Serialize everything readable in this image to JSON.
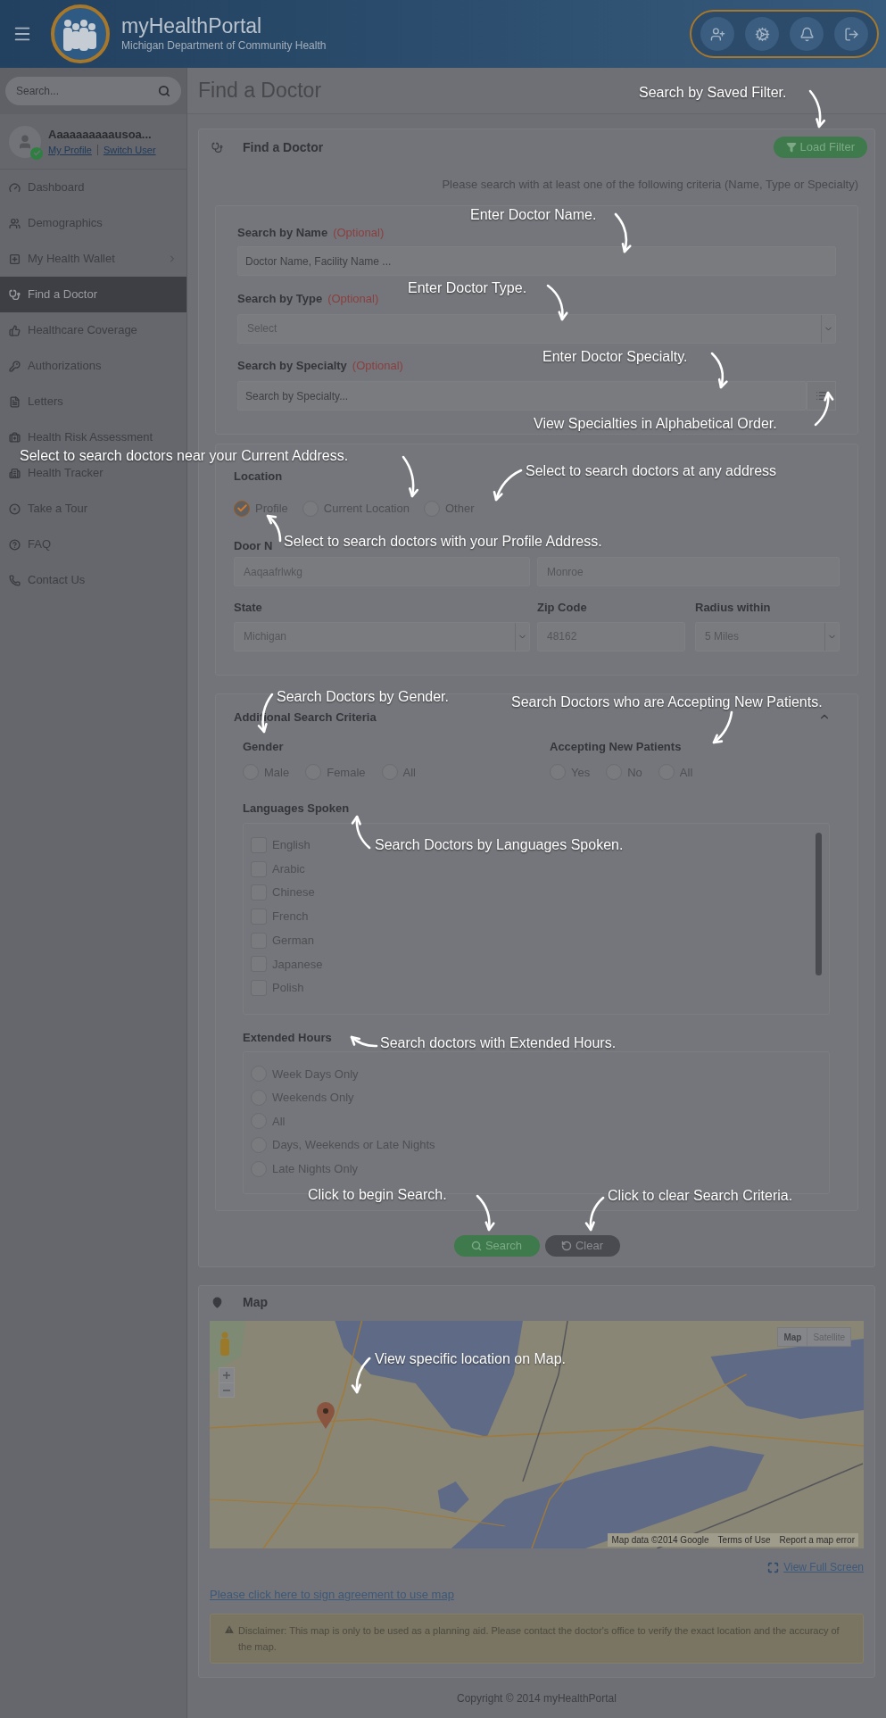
{
  "header": {
    "title": "myHealthPortal",
    "subtitle": "Michigan Department of Community Health"
  },
  "sidebar": {
    "search": {
      "placeholder": "Search..."
    },
    "user": {
      "name": "Aaaaaaaaaausoa...",
      "verified": true,
      "profile_link": "My Profile",
      "switch_link": "Switch User"
    },
    "items": [
      {
        "label": "Dashboard",
        "kind": "dashboard",
        "selected": false,
        "submenu": false
      },
      {
        "label": "Demographics",
        "kind": "people",
        "selected": false,
        "submenu": false
      },
      {
        "label": "My Health Wallet",
        "kind": "wallet",
        "selected": false,
        "submenu": true
      },
      {
        "label": "Find a Doctor",
        "kind": "doctor",
        "selected": true,
        "submenu": false
      },
      {
        "label": "Healthcare Coverage",
        "kind": "coverage",
        "selected": false,
        "submenu": false
      },
      {
        "label": "Authorizations",
        "kind": "key",
        "selected": false,
        "submenu": false
      },
      {
        "label": "Letters",
        "kind": "letter",
        "selected": false,
        "submenu": false
      },
      {
        "label": "Health Risk Assessment",
        "kind": "risk",
        "selected": false,
        "submenu": false
      },
      {
        "label": "Health Tracker",
        "kind": "tracker",
        "selected": false,
        "submenu": false
      },
      {
        "label": "Take a Tour",
        "kind": "tour",
        "selected": false,
        "submenu": false
      },
      {
        "label": "FAQ",
        "kind": "faq",
        "selected": false,
        "submenu": false
      },
      {
        "label": "Contact Us",
        "kind": "contact",
        "selected": false,
        "submenu": false
      }
    ]
  },
  "page_title": "Find a Doctor",
  "search_panel": {
    "title": "Find a Doctor",
    "load_filter": "Load Filter",
    "hint": "Please search with at least one of the following criteria (Name, Type or Specialty)",
    "name": {
      "label": "Search by Name",
      "optional": "(Optional)",
      "placeholder": "Doctor Name, Facility Name ..."
    },
    "type": {
      "label": "Search by Type",
      "optional": "(Optional)",
      "value": "Select"
    },
    "specialty": {
      "label": "Search by Specialty",
      "optional": "(Optional)",
      "placeholder": "Search by Specialty..."
    },
    "location": {
      "label": "Location",
      "options": [
        {
          "label": "Profile",
          "selected": true
        },
        {
          "label": "Current Location",
          "selected": false
        },
        {
          "label": "Other",
          "selected": false
        }
      ],
      "address": {
        "label": "Door N",
        "street": "Aaqaafrlwkg",
        "city": "Monroe"
      },
      "state": {
        "label": "State",
        "value": "Michigan"
      },
      "zip": {
        "label": "Zip Code",
        "value": "48162"
      },
      "radius": {
        "label": "Radius within",
        "value": "5 Miles"
      }
    },
    "additional": {
      "title": "Additional Search Criteria",
      "expanded": true,
      "gender": {
        "label": "Gender",
        "options": [
          {
            "label": "Male",
            "selected": false
          },
          {
            "label": "Female",
            "selected": false
          },
          {
            "label": "All",
            "selected": false
          }
        ]
      },
      "accepting": {
        "label": "Accepting New Patients",
        "options": [
          {
            "label": "Yes",
            "selected": false
          },
          {
            "label": "No",
            "selected": false
          },
          {
            "label": "All",
            "selected": false
          }
        ]
      },
      "languages": {
        "label": "Languages Spoken",
        "options": [
          {
            "label": "English",
            "checked": false
          },
          {
            "label": "Arabic",
            "checked": false
          },
          {
            "label": "Chinese",
            "checked": false
          },
          {
            "label": "French",
            "checked": false
          },
          {
            "label": "German",
            "checked": false
          },
          {
            "label": "Japanese",
            "checked": false
          },
          {
            "label": "Polish",
            "checked": false
          }
        ]
      },
      "hours": {
        "label": "Extended Hours",
        "options": [
          {
            "label": "Week Days Only",
            "selected": false
          },
          {
            "label": "Weekends Only",
            "selected": false
          },
          {
            "label": "All",
            "selected": false
          },
          {
            "label": "Days, Weekends or Late Nights",
            "selected": false
          },
          {
            "label": "Late Nights Only",
            "selected": false
          }
        ]
      }
    },
    "search_button": "Search",
    "clear_button": "Clear"
  },
  "map_panel": {
    "title": "Map",
    "map_types": [
      {
        "label": "Map",
        "selected": true
      },
      {
        "label": "Satellite",
        "selected": false
      }
    ],
    "attribution": [
      "Map data ©2014 Google",
      "Terms of Use",
      "Report a map error"
    ],
    "full_screen": "View Full Screen",
    "agreement_link": "Please click here to sign agreement to use map",
    "disclaimer": "Disclaimer: This map is only to be used as a planning aid. Please contact the doctor's office to verify the exact location and the accuracy of the map."
  },
  "footer": "Copyright © 2014 myHealthPortal",
  "tour_notes": [
    {
      "text": "Search by Saved Filter."
    },
    {
      "text": "Enter Doctor Name."
    },
    {
      "text": "Enter Doctor Type."
    },
    {
      "text": "Enter Doctor Specialty."
    },
    {
      "text": "View Specialties in Alphabetical Order."
    },
    {
      "text": "Select to search doctors near your Current Address."
    },
    {
      "text": "Select to search doctors at any address"
    },
    {
      "text": "Select to search doctors with your Profile Address."
    },
    {
      "text": "Search Doctors by Gender."
    },
    {
      "text": "Search Doctors who are Accepting New Patients."
    },
    {
      "text": "Search Doctors by Languages Spoken."
    },
    {
      "text": "Search doctors with Extended Hours."
    },
    {
      "text": "Click to begin Search."
    },
    {
      "text": "Click to clear Search Criteria."
    },
    {
      "text": "View specific location on Map."
    }
  ]
}
